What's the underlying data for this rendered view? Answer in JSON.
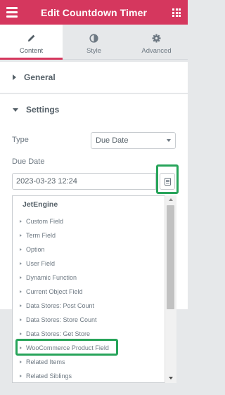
{
  "header": {
    "title": "Edit Countdown Timer",
    "menu_icon": "hamburger-icon",
    "apps_icon": "grid-icon",
    "bg_color": "#d5375e"
  },
  "tabs": [
    {
      "label": "Content",
      "icon": "pencil-icon",
      "active": true
    },
    {
      "label": "Style",
      "icon": "half-circle-icon",
      "active": false
    },
    {
      "label": "Advanced",
      "icon": "gear-icon",
      "active": false
    }
  ],
  "general": {
    "label": "General",
    "expanded": false
  },
  "settings": {
    "label": "Settings",
    "expanded": true,
    "type_label": "Type",
    "type_value": "Due Date",
    "due_label": "Due Date",
    "due_value": "2023-03-23 12:24",
    "calendar_icon": "calendar-icon"
  },
  "dropdown": {
    "group": "JetEngine",
    "items": [
      "Custom Field",
      "Term Field",
      "Option",
      "User Field",
      "Dynamic Function",
      "Current Object Field",
      "Data Stores: Post Count",
      "Data Stores: Store Count",
      "Data Stores: Get Store",
      "WooCommerce Product Field",
      "Related Items",
      "Related Siblings"
    ],
    "highlighted": "WooCommerce Product Field"
  },
  "highlight_color": "#27a45a"
}
